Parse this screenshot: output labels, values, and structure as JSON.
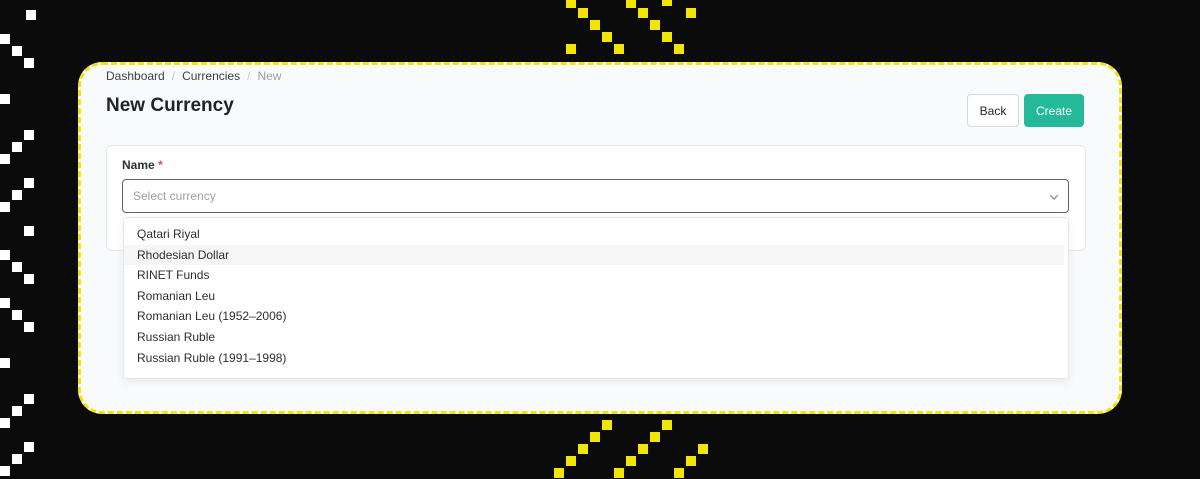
{
  "breadcrumb": {
    "items": [
      "Dashboard",
      "Currencies"
    ],
    "current": "New",
    "separator": "/"
  },
  "page": {
    "title": "New Currency"
  },
  "actions": {
    "back_label": "Back",
    "create_label": "Create"
  },
  "form": {
    "name_label": "Name",
    "required_marker": "*",
    "select_placeholder": "Select currency"
  },
  "dropdown": {
    "options": [
      "Qatari Riyal",
      "Rhodesian Dollar",
      "RINET Funds",
      "Romanian Leu",
      "Romanian Leu (1952–2006)",
      "Russian Ruble",
      "Russian Ruble (1991–1998)"
    ],
    "highlighted_index": 1
  },
  "theme": {
    "accent": "#24b999",
    "frame_border": "#f2e600",
    "background": "#0b0b0b",
    "required": "#e24c4c"
  },
  "icons": {
    "select_chevron": "chevron-down-icon"
  }
}
